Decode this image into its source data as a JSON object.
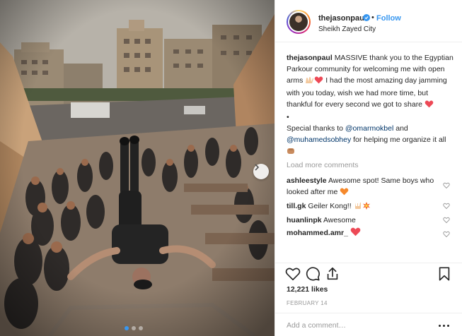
{
  "header": {
    "username": "thejasonpaul",
    "separator": "•",
    "follow_label": "Follow",
    "location": "Sheikh Zayed City"
  },
  "caption": {
    "username": "thejasonpaul",
    "text_1": "MASSIVE thank you to the Egyptian Parkour community for welcoming me with open arms",
    "text_2": "I had the most amazing day jamming with you today, wish we had more time, but thankful for every second we got to share",
    "bullet": "•",
    "text_3": "Special thanks to",
    "mention_1": "@omarmokbel",
    "and": "and",
    "mention_2": "@muhamedsobhey",
    "text_4": "for helping me organize it all"
  },
  "load_more_label": "Load more comments",
  "comments": [
    {
      "username": "ashleestyle",
      "text": "Awesome spot! Same boys who looked after me"
    },
    {
      "username": "till.gk",
      "text": "Geiler Kong!!"
    },
    {
      "username": "huanlinpk",
      "text": "Awesome"
    },
    {
      "username": "mohammed.amr_",
      "text": ""
    }
  ],
  "likes": "12,221 likes",
  "date": "FEBRUARY 14",
  "add_comment_placeholder": "Add a comment…",
  "photo": {
    "carousel_dots": 3,
    "active_dot": 0,
    "accent": "#3897f0"
  },
  "colors": {
    "accent_blue": "#3897f0",
    "heart_red": "#ed4956",
    "muted": "#999999",
    "text": "#262626"
  }
}
